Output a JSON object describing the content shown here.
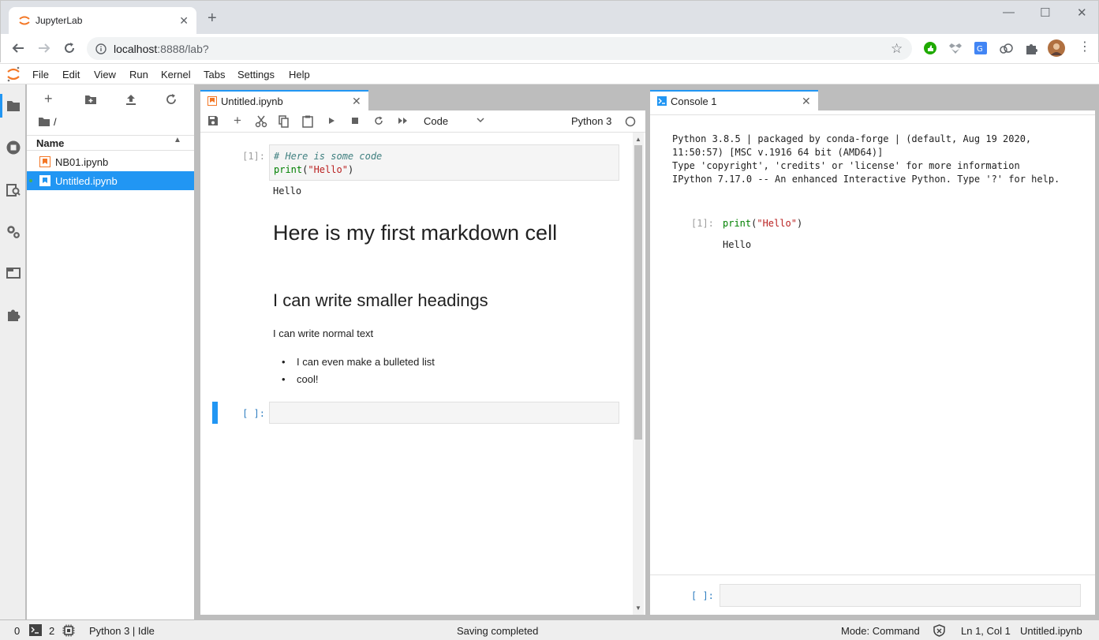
{
  "browser": {
    "tab_title": "JupyterLab",
    "url_host": "localhost",
    "url_path": ":8888/lab?"
  },
  "menubar": [
    "File",
    "Edit",
    "View",
    "Run",
    "Kernel",
    "Tabs",
    "Settings",
    "Help"
  ],
  "filebrowser": {
    "path": "/",
    "column_name": "Name",
    "files": [
      {
        "name": "NB01.ipynb",
        "selected": false
      },
      {
        "name": "Untitled.ipynb",
        "selected": true
      }
    ]
  },
  "notebook": {
    "tab_title": "Untitled.ipynb",
    "cell_type": "Code",
    "kernel": "Python 3",
    "cells": {
      "code1": {
        "prompt": "[1]:",
        "comment": "# Here is some code",
        "fn": "print",
        "arg": "\"Hello\"",
        "output": "Hello"
      },
      "markdown": {
        "h1": "Here is my first markdown cell",
        "h2": "I can write smaller headings",
        "para": "I can write normal text",
        "bullets": [
          "I can even make a bulleted list",
          "cool!"
        ]
      },
      "empty_prompt": "[ ]:"
    }
  },
  "console": {
    "tab_title": "Console 1",
    "banner": [
      "Python 3.8.5 | packaged by conda-forge | (default, Aug 19 2020,",
      "11:50:57) [MSC v.1916 64 bit (AMD64)]",
      "Type 'copyright', 'credits' or 'license' for more information",
      "IPython 7.17.0 -- An enhanced Interactive Python. Type '?' for help."
    ],
    "cell_prompt": "[1]:",
    "cell_fn": "print",
    "cell_arg": "\"Hello\"",
    "cell_open": "(",
    "cell_close": ")",
    "output": "Hello",
    "input_prompt": "[ ]:"
  },
  "statusbar": {
    "terminals": "0",
    "kernels": "2",
    "kernel_status": "Python 3 | Idle",
    "message": "Saving completed",
    "mode": "Mode: Command",
    "position": "Ln 1, Col 1",
    "file": "Untitled.ipynb"
  },
  "colors": {
    "accent": "#2196f3",
    "jupyter_orange": "#f37726"
  }
}
